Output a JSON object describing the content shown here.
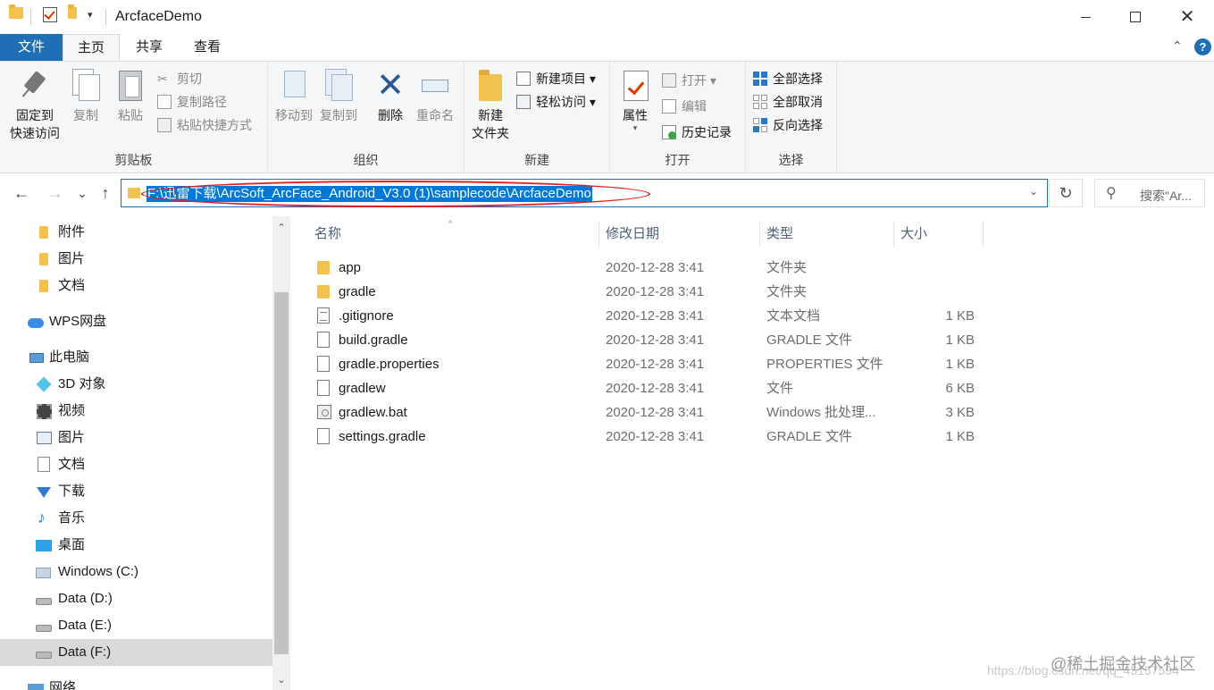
{
  "window": {
    "title": "ArcfaceDemo",
    "qa_customize": "▾",
    "controls": {
      "minimize": "—",
      "maximize": "☐",
      "close": "✕"
    }
  },
  "tabs": {
    "file": "文件",
    "home": "主页",
    "share": "共享",
    "view": "查看",
    "collapse": "⌃",
    "help": "?"
  },
  "ribbon": {
    "clipboard": {
      "label": "剪贴板",
      "pin": "固定到\n快速访问",
      "pin_line1": "固定到",
      "pin_line2": "快速访问",
      "copy": "复制",
      "paste": "粘贴",
      "cut": "剪切",
      "copy_path": "复制路径",
      "paste_shortcut": "粘贴快捷方式"
    },
    "organize": {
      "label": "组织",
      "move_to": "移动到",
      "copy_to": "复制到",
      "delete": "删除",
      "rename": "重命名"
    },
    "new": {
      "label": "新建",
      "new_folder_line1": "新建",
      "new_folder_line2": "文件夹",
      "new_item": "新建项目 ▾",
      "easy_access": "轻松访问 ▾"
    },
    "open": {
      "label": "打开",
      "properties": "属性",
      "open": "打开 ▾",
      "edit": "编辑",
      "history": "历史记录"
    },
    "select": {
      "label": "选择",
      "select_all": "全部选择",
      "select_none": "全部取消",
      "invert": "反向选择"
    }
  },
  "address": {
    "path": "F:\\迅雷下载\\ArcSoft_ArcFace_Android_V3.0 (1)\\samplecode\\ArcfaceDemo",
    "search_placeholder": "搜索\"Ar...",
    "nav_back": "←",
    "nav_forward": "→",
    "nav_recent": "⌄",
    "nav_up": "↑",
    "dropdown": "⌄",
    "refresh": "↻",
    "search_icon": "⚲"
  },
  "nav": {
    "items": [
      {
        "label": "附件",
        "icon": "folder-icon"
      },
      {
        "label": "图片",
        "icon": "folder-icon"
      },
      {
        "label": "文档",
        "icon": "folder-icon"
      },
      {
        "label": "WPS网盘",
        "icon": "cloud-icon"
      },
      {
        "label": "此电脑",
        "icon": "pc-icon"
      },
      {
        "label": "3D 对象",
        "icon": "cube-icon"
      },
      {
        "label": "视频",
        "icon": "video-icon"
      },
      {
        "label": "图片",
        "icon": "picture-icon"
      },
      {
        "label": "文档",
        "icon": "document-icon"
      },
      {
        "label": "下载",
        "icon": "download-icon"
      },
      {
        "label": "音乐",
        "icon": "music-icon"
      },
      {
        "label": "桌面",
        "icon": "desktop-icon"
      },
      {
        "label": "Windows (C:)",
        "icon": "windows-drive-icon"
      },
      {
        "label": "Data (D:)",
        "icon": "drive-icon"
      },
      {
        "label": "Data (E:)",
        "icon": "drive-icon"
      },
      {
        "label": "Data (F:)",
        "icon": "drive-icon"
      },
      {
        "label": "网络",
        "icon": "network-icon"
      }
    ],
    "scroll_up": "⌃",
    "scroll_down": "⌄"
  },
  "files": {
    "columns": {
      "name": "名称",
      "modified": "修改日期",
      "type": "类型",
      "size": "大小",
      "sort_caret": "^"
    },
    "rows": [
      {
        "name": "app",
        "modified": "2020-12-28 3:41",
        "type": "文件夹",
        "size": "",
        "icon": "folder-icon"
      },
      {
        "name": "gradle",
        "modified": "2020-12-28 3:41",
        "type": "文件夹",
        "size": "",
        "icon": "folder-icon"
      },
      {
        "name": ".gitignore",
        "modified": "2020-12-28 3:41",
        "type": "文本文档",
        "size": "1 KB",
        "icon": "text-file-icon"
      },
      {
        "name": "build.gradle",
        "modified": "2020-12-28 3:41",
        "type": "GRADLE 文件",
        "size": "1 KB",
        "icon": "file-icon"
      },
      {
        "name": "gradle.properties",
        "modified": "2020-12-28 3:41",
        "type": "PROPERTIES 文件",
        "size": "1 KB",
        "icon": "file-icon"
      },
      {
        "name": "gradlew",
        "modified": "2020-12-28 3:41",
        "type": "文件",
        "size": "6 KB",
        "icon": "file-icon"
      },
      {
        "name": "gradlew.bat",
        "modified": "2020-12-28 3:41",
        "type": "Windows 批处理...",
        "size": "3 KB",
        "icon": "batch-file-icon"
      },
      {
        "name": "settings.gradle",
        "modified": "2020-12-28 3:41",
        "type": "GRADLE 文件",
        "size": "1 KB",
        "icon": "file-icon"
      }
    ]
  },
  "watermark": {
    "brand": "@稀土掘金技术社区",
    "url": "https://blog.csdn.net/qq_45157594"
  }
}
